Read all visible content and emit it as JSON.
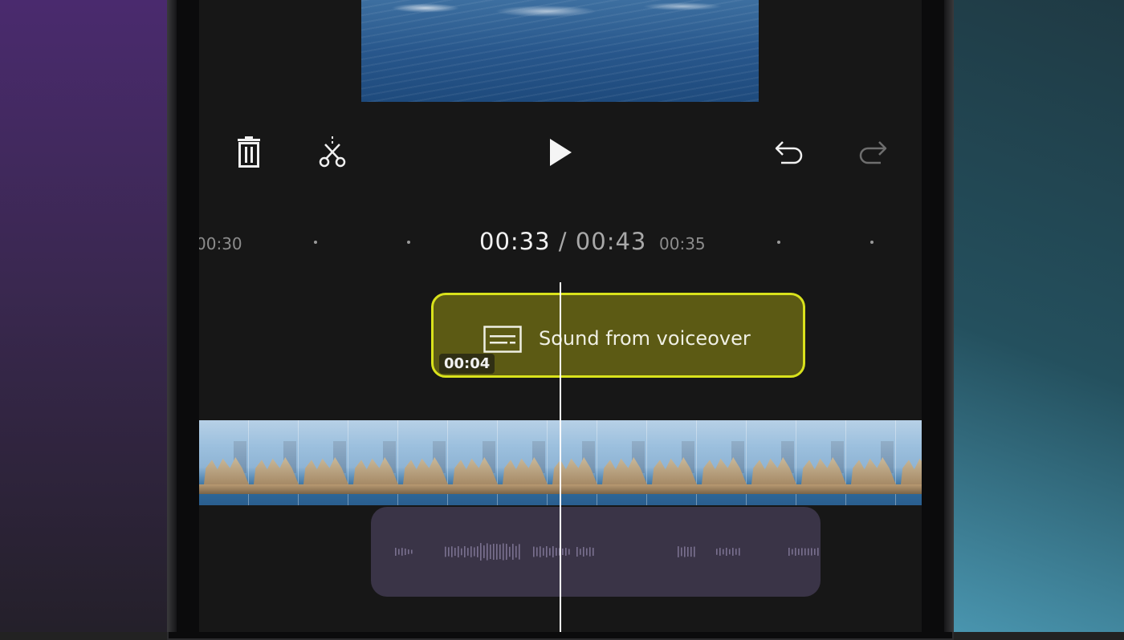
{
  "toolbar": {
    "delete_icon": "trash-icon",
    "split_icon": "scissors-split-icon",
    "play_icon": "play-icon",
    "undo_icon": "undo-icon",
    "redo_icon": "redo-icon"
  },
  "timeline": {
    "left_tick": "00:30",
    "right_tick": "00:35",
    "current_time": "00:33",
    "separator": "/",
    "total_time": "00:43"
  },
  "caption_clip": {
    "label": "Sound from voiceover",
    "duration": "00:04",
    "icon": "captions-icon",
    "accent_color": "#d9e21c"
  },
  "colors": {
    "screen_bg": "#171717",
    "caption_fill": "#5c5a14",
    "audio_track": "#3a3447",
    "playhead": "#ffffff"
  }
}
